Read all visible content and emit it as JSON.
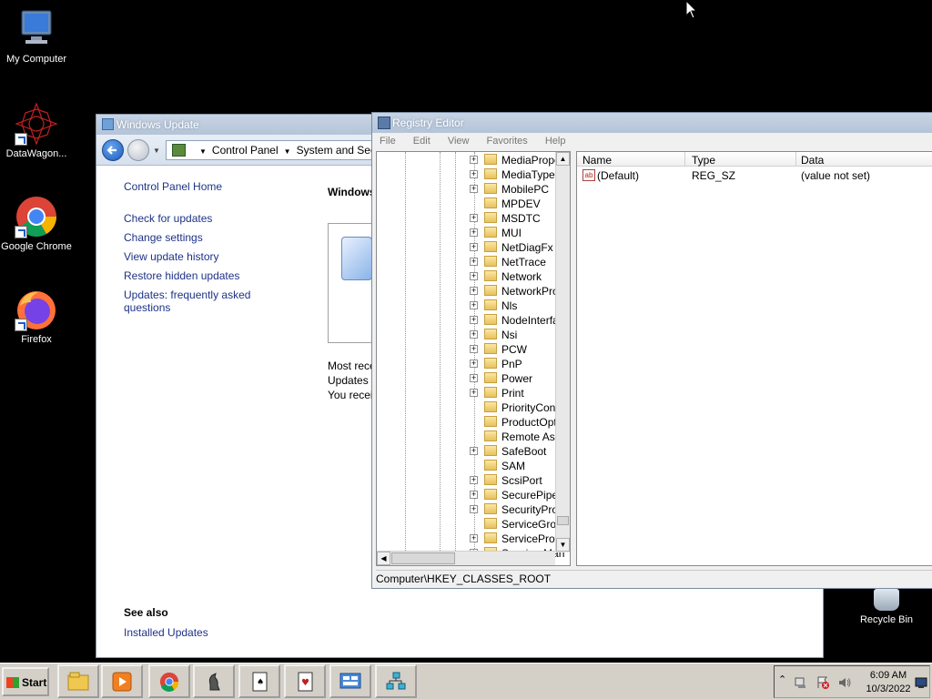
{
  "desktop": {
    "icons": [
      {
        "label": "My Computer"
      },
      {
        "label": "DataWagon..."
      },
      {
        "label": "Google Chrome"
      },
      {
        "label": "Firefox"
      }
    ],
    "recycle_bin": "Recycle Bin"
  },
  "windows_update": {
    "title": "Windows Update",
    "breadcrumbs": [
      "Control Panel",
      "System and Security"
    ],
    "left_links": [
      "Control Panel Home",
      "Check for updates",
      "Change settings",
      "View update history",
      "Restore hidden updates",
      "Updates: frequently asked questions"
    ],
    "main_heading": "Windows",
    "info_lines": [
      "Most rece",
      "Updates w",
      "You receiv"
    ],
    "see_also_heading": "See also",
    "see_also_links": [
      "Installed Updates"
    ]
  },
  "registry_editor": {
    "title": "Registry Editor",
    "menu": [
      "File",
      "Edit",
      "View",
      "Favorites",
      "Help"
    ],
    "tree_items": [
      {
        "label": "MediaProper",
        "expandable": true
      },
      {
        "label": "MediaTypes",
        "expandable": true
      },
      {
        "label": "MobilePC",
        "expandable": true
      },
      {
        "label": "MPDEV",
        "expandable": false
      },
      {
        "label": "MSDTC",
        "expandable": true
      },
      {
        "label": "MUI",
        "expandable": true
      },
      {
        "label": "NetDiagFx",
        "expandable": true
      },
      {
        "label": "NetTrace",
        "expandable": true
      },
      {
        "label": "Network",
        "expandable": true
      },
      {
        "label": "NetworkProv",
        "expandable": true
      },
      {
        "label": "Nls",
        "expandable": true
      },
      {
        "label": "NodeInterfa",
        "expandable": true
      },
      {
        "label": "Nsi",
        "expandable": true
      },
      {
        "label": "PCW",
        "expandable": true
      },
      {
        "label": "PnP",
        "expandable": true
      },
      {
        "label": "Power",
        "expandable": true
      },
      {
        "label": "Print",
        "expandable": true
      },
      {
        "label": "PriorityContr",
        "expandable": false
      },
      {
        "label": "ProductOptic",
        "expandable": false
      },
      {
        "label": "Remote Assi",
        "expandable": false
      },
      {
        "label": "SafeBoot",
        "expandable": true
      },
      {
        "label": "SAM",
        "expandable": false
      },
      {
        "label": "ScsiPort",
        "expandable": true
      },
      {
        "label": "SecurePipeS",
        "expandable": true
      },
      {
        "label": "SecurityProv",
        "expandable": true
      },
      {
        "label": "ServiceGrou",
        "expandable": false
      },
      {
        "label": "ServiceProvi",
        "expandable": true
      },
      {
        "label": "Session Man",
        "expandable": true
      }
    ],
    "columns": [
      "Name",
      "Type",
      "Data"
    ],
    "values": [
      {
        "name": "(Default)",
        "type": "REG_SZ",
        "data": "(value not set)"
      }
    ],
    "status_path": "Computer\\HKEY_CLASSES_ROOT"
  },
  "taskbar": {
    "start_label": "Start",
    "buttons": [
      "file-explorer",
      "media-player",
      "google-chrome",
      "chess",
      "solitaire",
      "hearts",
      "network-console",
      "hierarchy-app"
    ],
    "clock_time": "6:09 AM",
    "clock_date": "10/3/2022"
  }
}
